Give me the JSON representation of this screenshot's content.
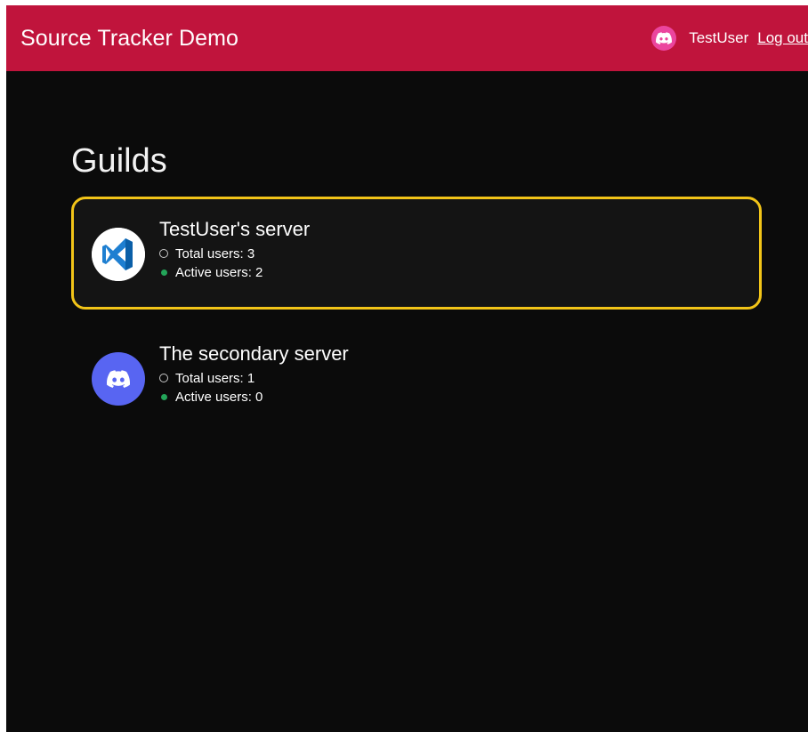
{
  "header": {
    "title": "Source Tracker Demo",
    "username": "TestUser",
    "logout_label": "Log out",
    "background_color": "#c0143c",
    "avatar_icon": "discord-logo-icon",
    "avatar_color": "#eb459e"
  },
  "main": {
    "title": "Guilds",
    "guilds": [
      {
        "name": "TestUser's server",
        "icon": "vscode-logo-icon",
        "total_label": "Total users: 3",
        "active_label": "Active users: 2",
        "selected": true
      },
      {
        "name": "The secondary server",
        "icon": "discord-logo-icon",
        "total_label": "Total users: 1",
        "active_label": "Active users: 0",
        "selected": false
      }
    ]
  },
  "colors": {
    "selection_border": "#f2c418",
    "active_status": "#23a559",
    "discord_blurple": "#5865f2",
    "vscode_blue": "#1e7fd1"
  }
}
